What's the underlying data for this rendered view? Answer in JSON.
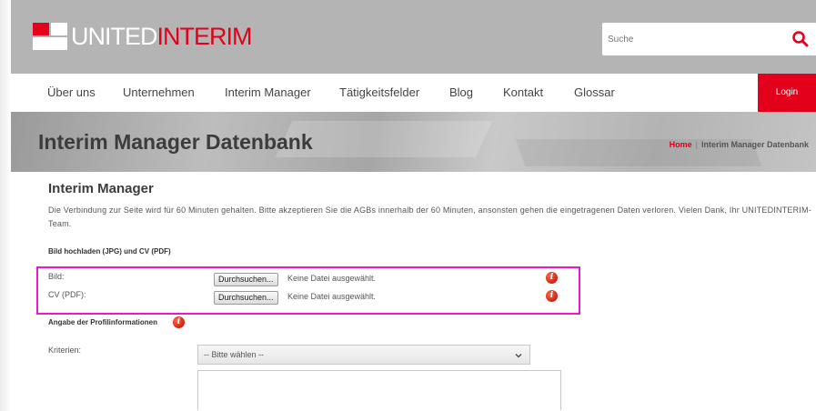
{
  "logo": {
    "part1": "UNITED",
    "part2": "INTERIM"
  },
  "search": {
    "placeholder": "Suche"
  },
  "nav": {
    "items": [
      {
        "label": "Über uns"
      },
      {
        "label": "Unternehmen"
      },
      {
        "label": "Interim Manager"
      },
      {
        "label": "Tätigkeitsfelder"
      },
      {
        "label": "Blog"
      },
      {
        "label": "Kontakt"
      },
      {
        "label": "Glossar"
      }
    ],
    "login": "Login"
  },
  "banner": {
    "title": "Interim Manager Datenbank",
    "breadcrumb_home": "Home",
    "breadcrumb_sep": "|",
    "breadcrumb_current": "Interim Manager Datenbank"
  },
  "content": {
    "title": "Interim Manager",
    "intro": "Die Verbindung zur Seite wird für 60 Minuten gehalten. Bitte akzeptieren Sie die AGBs innerhalb der 60 Minuten, ansonsten gehen die eingetragenen Daten verloren. Vielen Dank, Ihr UNITEDINTERIM-Team.",
    "upload_heading": "Bild hochladen (JPG) und CV (PDF)",
    "upload": {
      "bild_label": "Bild:",
      "cv_label": "CV (PDF):",
      "browse_label": "Durchsuchen...",
      "no_file": "Keine Datei ausgewählt."
    },
    "profile_heading": "Angabe der Profilinformationen",
    "criteria_label": "Kriterien:",
    "criteria_selected": "-- Bitte wählen --"
  },
  "colors": {
    "brand_red": "#e2001a",
    "highlight": "#ee17c8",
    "header_gray": "#b4b4b4"
  },
  "icons": [
    "search-icon",
    "info-icon",
    "chevron-down-icon"
  ]
}
